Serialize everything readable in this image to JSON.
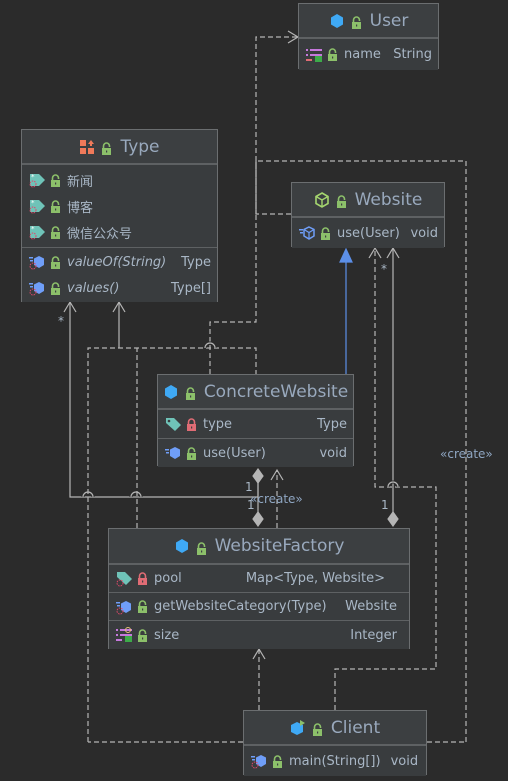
{
  "diagram": {
    "title": "UML class diagram",
    "colors": {
      "background": "#2b2b2b",
      "class_fill": "#3c3f41",
      "class_border": "#6b6e70",
      "title_text": "#99a9bd",
      "member_text": "#a9b7c6",
      "edge": "#b5b5b5",
      "realization_edge": "#5c8fe8",
      "lock_public": "#8cc06a",
      "lock_private": "#e06c75"
    }
  },
  "classes": {
    "user": {
      "name": "User",
      "kind": "class-icon",
      "fields": [
        {
          "name": "name",
          "type": "String",
          "icon": "property-icon",
          "access": "public"
        }
      ]
    },
    "type": {
      "name": "Type",
      "kind": "enum-icon",
      "constants": [
        {
          "name": "新闻",
          "icon": "enum-constant-icon",
          "access": "public"
        },
        {
          "name": "博客",
          "icon": "enum-constant-icon",
          "access": "public"
        },
        {
          "name": "微信公众号",
          "icon": "enum-constant-icon",
          "access": "public"
        }
      ],
      "methods": [
        {
          "name": "valueOf(String)",
          "type": "Type",
          "icon": "static-method-icon",
          "access": "public",
          "italic": true
        },
        {
          "name": "values()",
          "type": "Type[]",
          "icon": "static-method-icon",
          "access": "public",
          "italic": true
        }
      ]
    },
    "website": {
      "name": "Website",
      "kind": "interface-icon",
      "methods": [
        {
          "name": "use(User)",
          "type": "void",
          "icon": "abstract-method-icon",
          "access": "public"
        }
      ]
    },
    "concrete_website": {
      "name": "ConcreteWebsite",
      "kind": "class-icon",
      "fields": [
        {
          "name": "type",
          "type": "Type",
          "icon": "field-icon",
          "access": "private"
        }
      ],
      "methods": [
        {
          "name": "use(User)",
          "type": "void",
          "icon": "method-icon",
          "access": "public"
        }
      ]
    },
    "website_factory": {
      "name": "WebsiteFactory",
      "kind": "class-icon",
      "fields": [
        {
          "name": "pool",
          "type": "Map<Type, Website>",
          "icon": "static-field-icon",
          "access": "private"
        }
      ],
      "methods": [
        {
          "name": "getWebsiteCategory(Type)",
          "type": "Website",
          "icon": "static-method-icon",
          "access": "public"
        }
      ],
      "properties": [
        {
          "name": "size",
          "type": "Integer",
          "icon": "property-icon",
          "access": "public"
        }
      ]
    },
    "client": {
      "name": "Client",
      "kind": "main-class-icon",
      "methods": [
        {
          "name": "main(String[])",
          "type": "void",
          "icon": "static-method-icon",
          "access": "public"
        }
      ]
    }
  },
  "edge_labels": {
    "mult_type_star": "*",
    "mult_website_star": "*",
    "mult_cw_1a": "1",
    "mult_cw_1b": "1",
    "mult_wf_1": "1",
    "create_1": "«create»",
    "create_2": "«create»"
  }
}
